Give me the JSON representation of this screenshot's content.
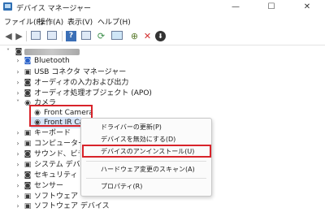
{
  "window": {
    "title": "デバイス マネージャー",
    "controls": {
      "minimize": "—",
      "maximize": "☐",
      "close": "✕"
    }
  },
  "menubar": [
    "ファイル(F)",
    "操作(A)",
    "表示(V)",
    "ヘルプ(H)"
  ],
  "toolbar": {
    "back": "◀",
    "forward": "▶",
    "help": "?",
    "scan": "⟳",
    "disable": "⬇",
    "uninstall": "✕",
    "update": "⊕"
  },
  "tree": {
    "expanders": {
      "collapsed": "›",
      "expanded": "˅"
    },
    "glyphs": {
      "folder": "▣",
      "device": "◙",
      "camera": "◉"
    },
    "items": [
      {
        "label": "Bluetooth"
      },
      {
        "label": "USB コネクタ マネージャー"
      },
      {
        "label": "オーディオの入力および出力"
      },
      {
        "label": "オーディオ処理オブジェクト (APO)"
      },
      {
        "label": "カメラ"
      },
      {
        "label": "Front Camera"
      },
      {
        "label": "Front IR Cam"
      },
      {
        "label": "キーボード"
      },
      {
        "label": "コンピューター"
      },
      {
        "label": "サウンド、ビデオ、およびゲーム コントローラー"
      },
      {
        "label": "システム デバイス"
      },
      {
        "label": "セキュリティ デバイス"
      },
      {
        "label": "センサー"
      },
      {
        "label": "ソフトウェア コンポーネント"
      },
      {
        "label": "ソフトウェア デバイス"
      }
    ]
  },
  "context_menu": {
    "items": [
      {
        "label": "ドライバーの更新(P)"
      },
      {
        "label": "デバイスを無効にする(D)"
      },
      {
        "label": "デバイスのアンインストール(U)"
      },
      {
        "label": "ハードウェア変更のスキャン(A)"
      },
      {
        "label": "プロパティ(R)"
      }
    ]
  },
  "colors": {
    "highlight_box": "#d8232a",
    "selection": "#d6e4f7",
    "uninstall_icon": "#d32f2f"
  }
}
